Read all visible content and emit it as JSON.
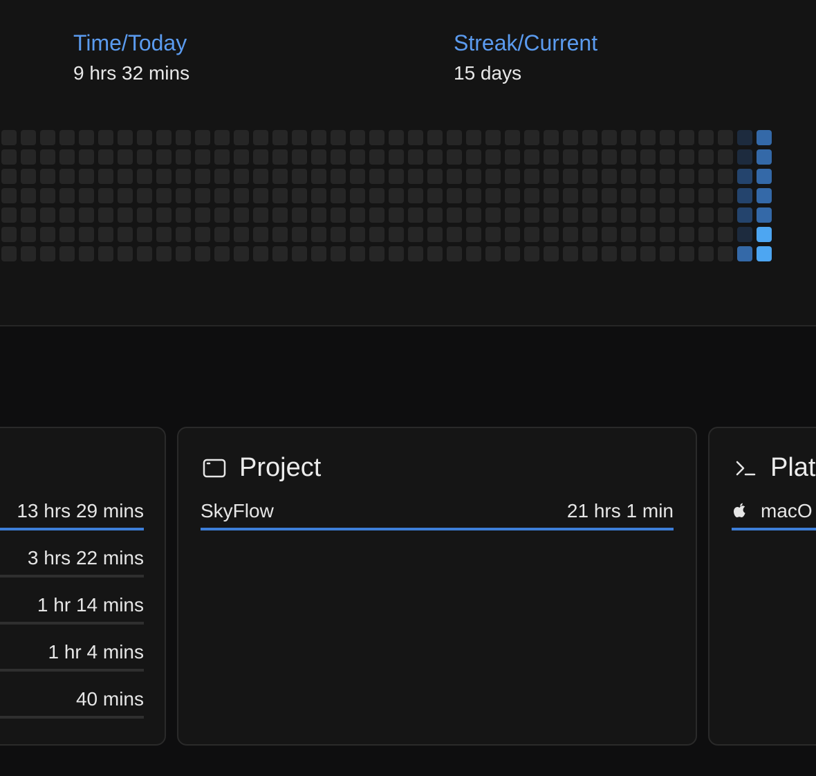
{
  "stats": [
    {
      "label": "Time/Today",
      "value": "9 hrs 32 mins"
    },
    {
      "label": "Streak/Current",
      "value": "15 days"
    }
  ],
  "heatmap": {
    "empty_color": "#262626",
    "level_colors": [
      "#262626",
      "#1d2b3e",
      "#24446d",
      "#3469a8",
      "#3f8ad9",
      "#4da6f2"
    ],
    "active_columns": [
      {
        "levels": [
          1,
          1,
          2,
          2,
          2,
          1,
          3
        ]
      },
      {
        "levels": [
          3,
          3,
          3,
          3,
          3,
          5,
          5
        ]
      }
    ]
  },
  "cards": {
    "left": {
      "rows": [
        {
          "time": "13 hrs 29 mins",
          "primary": true
        },
        {
          "time": "3 hrs 22 mins",
          "primary": false
        },
        {
          "time": "1 hr 14 mins",
          "primary": false
        },
        {
          "time": "1 hr 4 mins",
          "primary": false
        },
        {
          "time": "40 mins",
          "primary": false
        }
      ]
    },
    "project": {
      "title": "Project",
      "icon": "window-icon",
      "rows": [
        {
          "name": "SkyFlow",
          "time": "21 hrs 1 min",
          "primary": true
        }
      ]
    },
    "platform": {
      "title": "Platf",
      "icon": "terminal-icon",
      "rows": [
        {
          "name": "macO",
          "icon": "apple-icon",
          "primary": true
        }
      ]
    }
  },
  "colors": {
    "accent": "#5b9bef",
    "bar_primary": "#3d7ed8",
    "bar_secondary": "#2f2f2f"
  }
}
